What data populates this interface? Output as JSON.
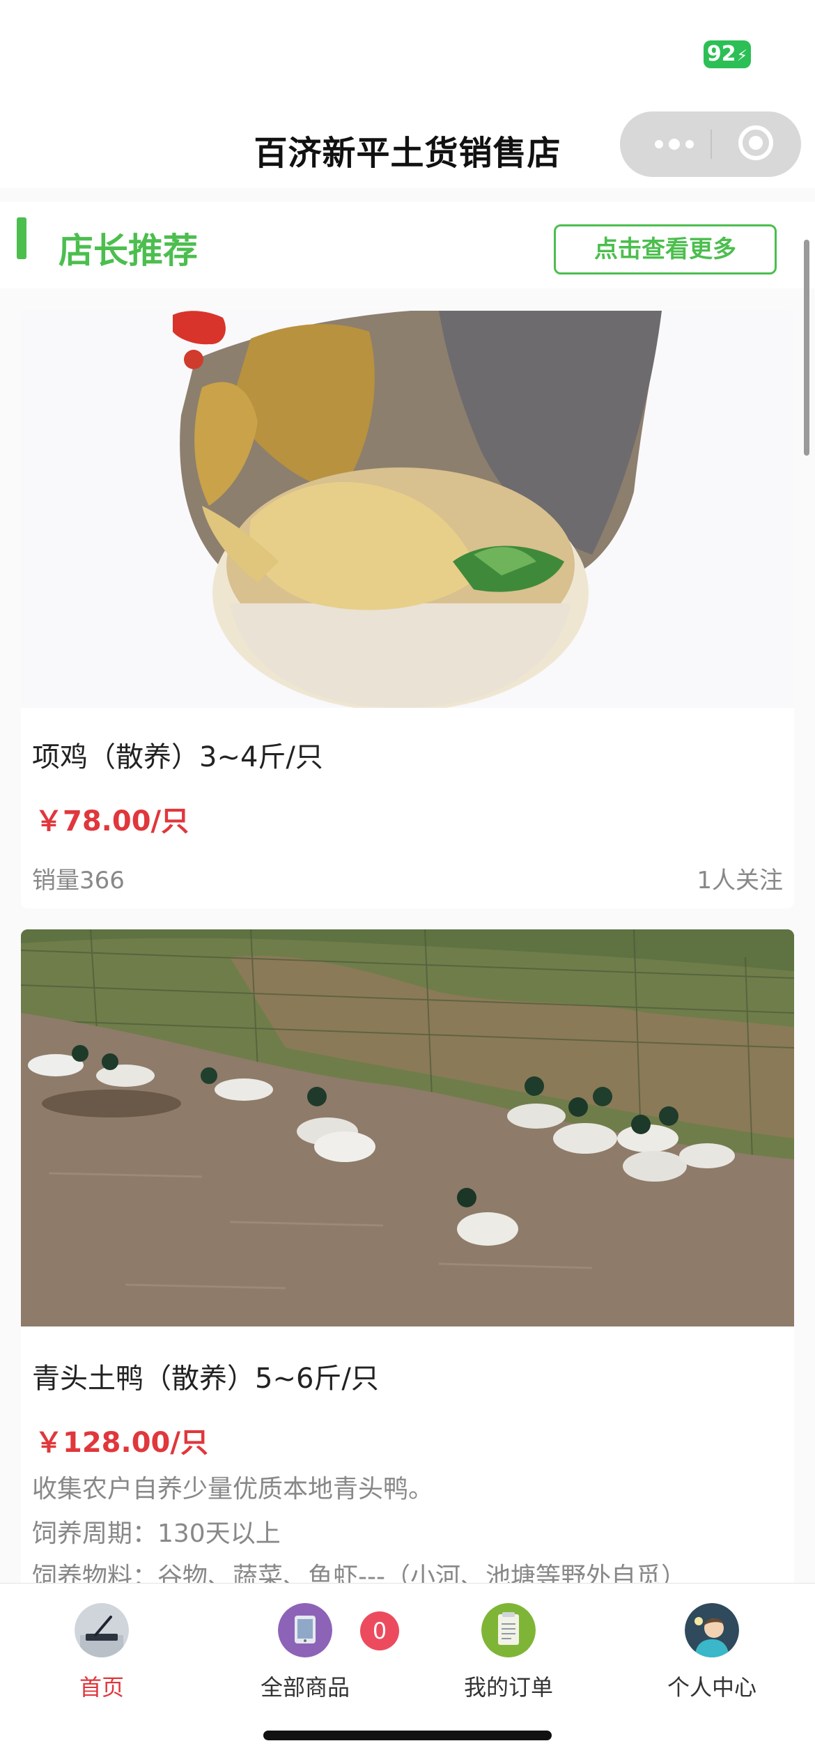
{
  "status_bar": {
    "battery": "92"
  },
  "nav": {
    "title": "百济新平土货销售店"
  },
  "section": {
    "title": "店长推荐",
    "more_label": "点击查看更多"
  },
  "products": [
    {
      "title": "项鸡（散养）3~4斤/只",
      "price": "￥78.00/只",
      "sales": "销量366",
      "followers": "1人关注"
    },
    {
      "title": "青头土鸭（散养）5~6斤/只",
      "price": "￥128.00/只",
      "description_lines": [
        "收集农户自养少量优质本地青头鸭。",
        "饲养周期：130天以上",
        "饲养物料：谷物、蔬菜、鱼虾---（小河、池塘等野外自觅）"
      ]
    }
  ],
  "tabs": [
    {
      "label": "首页",
      "icon": "tablet-pen-icon",
      "active": true
    },
    {
      "label": "全部商品",
      "icon": "tablet-icon",
      "badge": "0"
    },
    {
      "label": "我的订单",
      "icon": "notepad-icon"
    },
    {
      "label": "个人中心",
      "icon": "avatar-icon"
    }
  ],
  "colors": {
    "accent_green": "#4cbe4e",
    "price_red": "#e0373c",
    "badge_red": "#ec4b5e",
    "battery_green": "#2cbf55"
  }
}
